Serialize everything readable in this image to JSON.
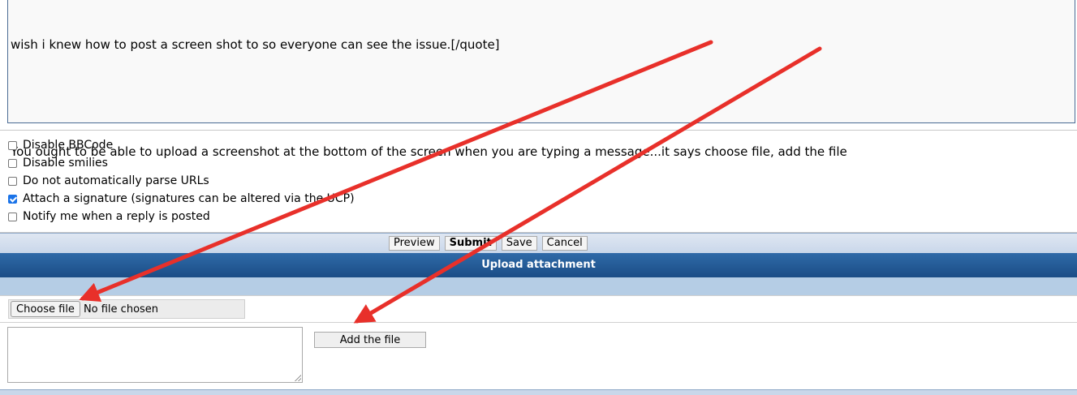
{
  "message": {
    "lines": [
      "wish i knew how to post a screen shot to so everyone can see the issue.[/quote]",
      "You ought to be able to upload a screenshot at the bottom of the screen when you are typing a message...it says choose file, add the file"
    ]
  },
  "options": [
    {
      "label": "Disable BBCode",
      "checked": false
    },
    {
      "label": "Disable smilies",
      "checked": false
    },
    {
      "label": "Do not automatically parse URLs",
      "checked": false
    },
    {
      "label": "Attach a signature (signatures can be altered via the UCP)",
      "checked": true
    },
    {
      "label": "Notify me when a reply is posted",
      "checked": false
    }
  ],
  "buttons": {
    "preview": "Preview",
    "submit": "Submit",
    "save": "Save",
    "cancel": "Cancel"
  },
  "upload": {
    "header": "Upload attachment",
    "choose_file": "Choose file",
    "no_file": "No file chosen",
    "add_file": "Add the file",
    "comment_value": ""
  },
  "colors": {
    "annotation_arrow": "#e8302a",
    "header_blue": "#1b4d86",
    "sub_bar": "#b5cde5"
  }
}
